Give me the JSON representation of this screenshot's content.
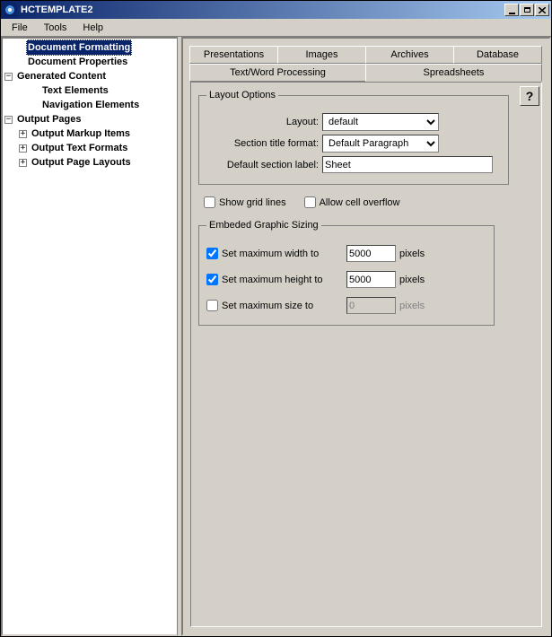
{
  "window": {
    "title": "HCTEMPLATE2",
    "min": "_",
    "max": "□",
    "close": "X"
  },
  "menu": {
    "file": "File",
    "tools": "Tools",
    "help": "Help"
  },
  "tree": {
    "n0": "Document Formatting",
    "n1": "Document Properties",
    "n2": "Generated Content",
    "n2a": "Text Elements",
    "n2b": "Navigation Elements",
    "n3": "Output Pages",
    "n3a": "Output Markup Items",
    "n3b": "Output Text Formats",
    "n3c": "Output Page Layouts"
  },
  "tabs": {
    "presentations": "Presentations",
    "images": "Images",
    "archives": "Archives",
    "database": "Database",
    "textwp": "Text/Word Processing",
    "spreadsheets": "Spreadsheets"
  },
  "layoutOptions": {
    "legend": "Layout Options",
    "layout_label": "Layout:",
    "layout_value": "default",
    "section_title_label": "Section title format:",
    "section_title_value": "Default Paragraph",
    "default_section_label": "Default section label:",
    "default_section_value": "Sheet"
  },
  "checks": {
    "grid": "Show grid lines",
    "overflow": "Allow cell overflow"
  },
  "sizing": {
    "legend": "Embeded Graphic Sizing",
    "maxw_label": "Set maximum width to",
    "maxw_value": "5000",
    "maxh_label": "Set maximum height to",
    "maxh_value": "5000",
    "maxs_label": "Set maximum size to",
    "maxs_value": "0",
    "pixels": "pixels"
  },
  "help": "?"
}
